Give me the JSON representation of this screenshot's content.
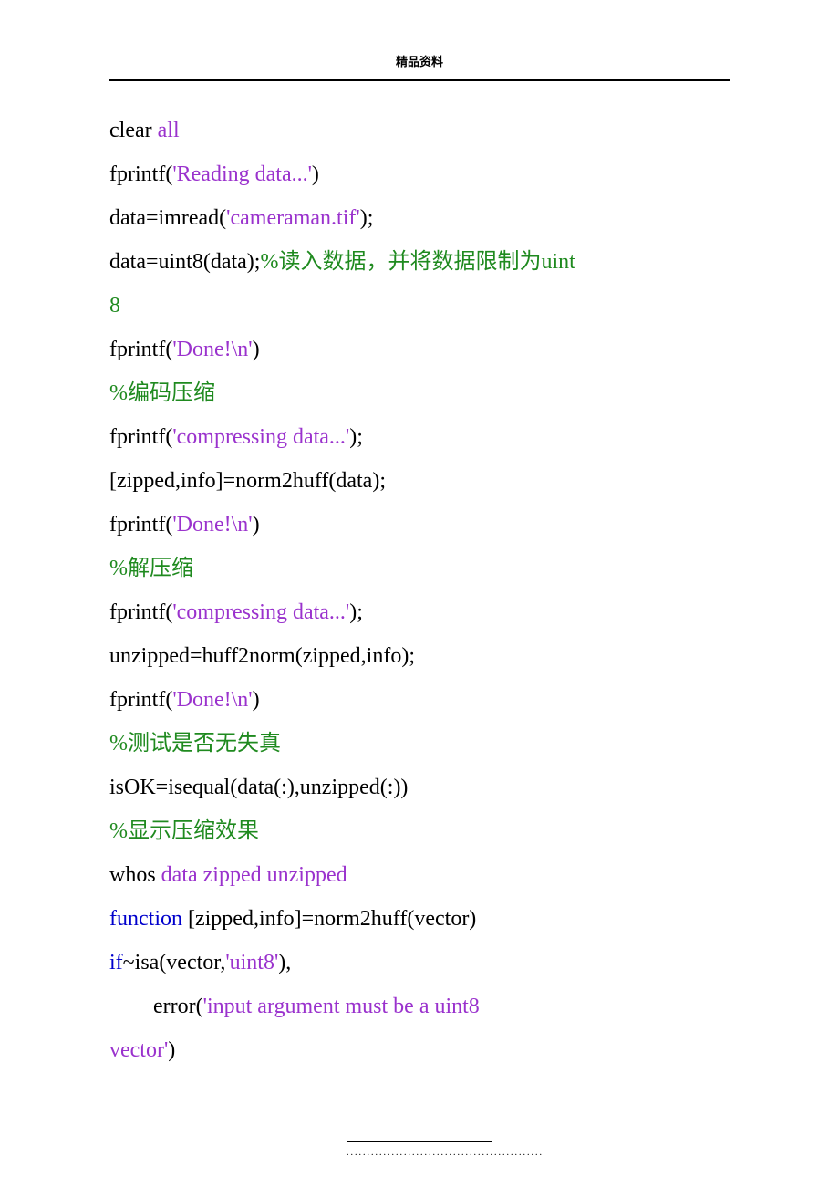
{
  "header": "精品资料",
  "footer": "................................................",
  "code": {
    "l1a": "clear ",
    "l1b": "all",
    "l2a": "fprintf(",
    "l2b": "'Reading data...'",
    "l2c": ")",
    "l3a": "data=imread(",
    "l3b": "'cameraman.tif'",
    "l3c": ");",
    "l4a": "data=uint8(data);",
    "l4b": "%读入数据，并将数据限制为uint",
    "l5a": "8",
    "l6a": "fprintf(",
    "l6b": "'Done!\\n'",
    "l6c": ")",
    "l7a": "%编码压缩",
    "l8a": "fprintf(",
    "l8b": "'compressing data...'",
    "l8c": ");",
    "l9a": "[zipped,info]=norm2huff(data);",
    "l10a": "fprintf(",
    "l10b": "'Done!\\n'",
    "l10c": ")",
    "l11a": "%解压缩",
    "l12a": "fprintf(",
    "l12b": "'compressing data...'",
    "l12c": ");",
    "l13a": "unzipped=huff2norm(zipped,info);",
    "l14a": "fprintf(",
    "l14b": "'Done!\\n'",
    "l14c": ")",
    "l15a": "%测试是否无失真",
    "l16a": "isOK=isequal(data(:),unzipped(:))",
    "l17a": "%显示压缩效果",
    "l18a": "whos ",
    "l18b": "data zipped unzipped",
    "l19a": "function ",
    "l19b": "[zipped,info]=norm2huff(vector)",
    "l20a": "if",
    "l20b": "~isa(vector,",
    "l20c": "'uint8'",
    "l20d": "),",
    "l21a": "error(",
    "l21b": "'input argument must be a uint8 ",
    "l22a": "vector'",
    "l22b": ")"
  }
}
